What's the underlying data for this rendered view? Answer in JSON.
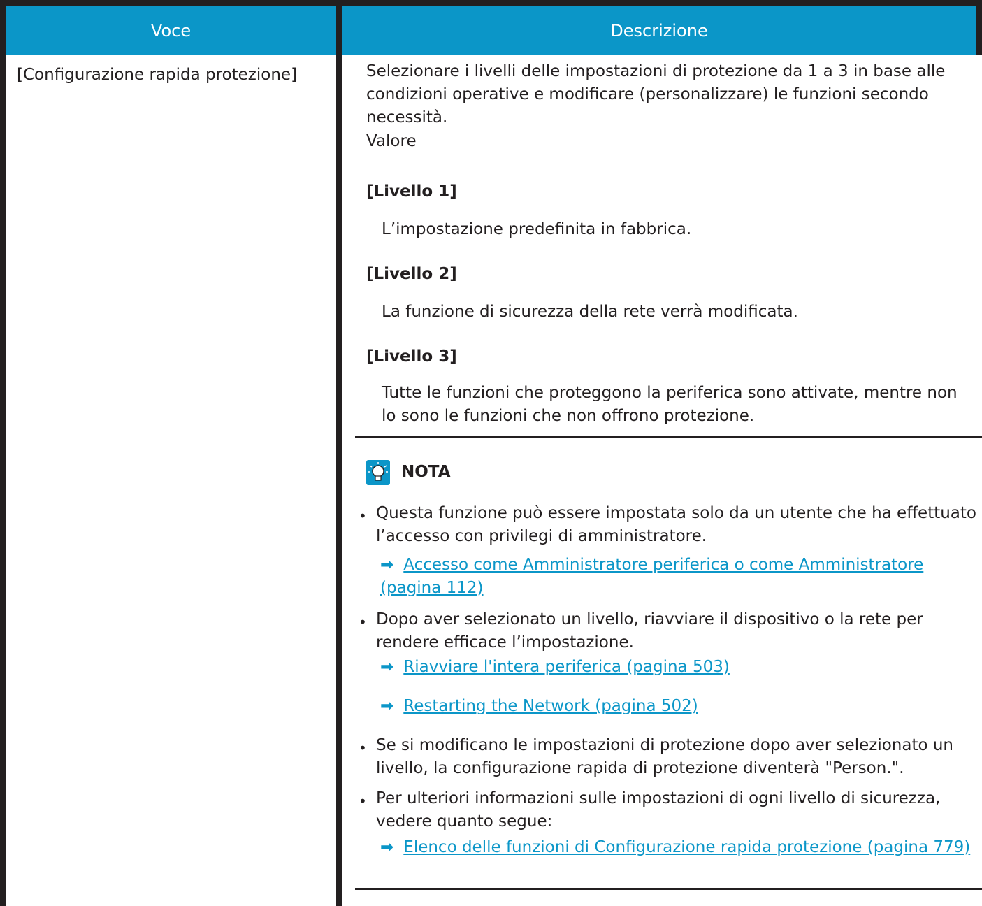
{
  "table": {
    "headers": [
      "Voce",
      "Descrizione"
    ],
    "row": {
      "item": "[Configurazione rapida protezione]",
      "intro": "Selezionare i livelli delle impostazioni di protezione da 1 a 3 in base alle condizioni operative e modificare (personalizzare) le funzioni secondo necessità.",
      "value_label": "Valore",
      "levels": [
        {
          "title": "[Livello 1]",
          "desc": "L’impostazione predefinita in fabbrica."
        },
        {
          "title": "[Livello 2]",
          "desc": "La funzione di sicurezza della rete verrà modificata."
        },
        {
          "title": "[Livello 3]",
          "desc": "Tutte le funzioni che proteggono la periferica sono attivate, mentre non lo sono le funzioni che non offrono protezione."
        }
      ],
      "note": {
        "label": "NOTA",
        "icon": "lightbulb-note-icon",
        "bullets": [
          {
            "text": "Questa funzione può essere impostata solo da un utente che ha effettuato l’accesso con privilegi di amministratore.",
            "links": [
              "Accesso come Amministratore periferica o come Amministratore (pagina 112)"
            ]
          },
          {
            "text": "Dopo aver selezionato un livello, riavviare il dispositivo o la rete per rendere efficace l’impostazione.",
            "links": [
              "Riavviare l'intera periferica (pagina 503)",
              "Restarting the Network (pagina 502)"
            ]
          },
          {
            "text": "Se si modificano le impostazioni di protezione dopo aver selezionato un livello, la configurazione rapida di protezione diventerà \"Person.\".",
            "links": []
          },
          {
            "text": "Per ulteriori informazioni sulle impostazioni di ogni livello di sicurezza, vedere quanto segue:",
            "links": [
              "Elenco delle funzioni di Configurazione rapida protezione (pagina 779)"
            ]
          }
        ]
      }
    }
  },
  "colors": {
    "header_bg": "#0b96c8",
    "link": "#0b96c8",
    "text": "#231f20",
    "border": "#231f20"
  }
}
